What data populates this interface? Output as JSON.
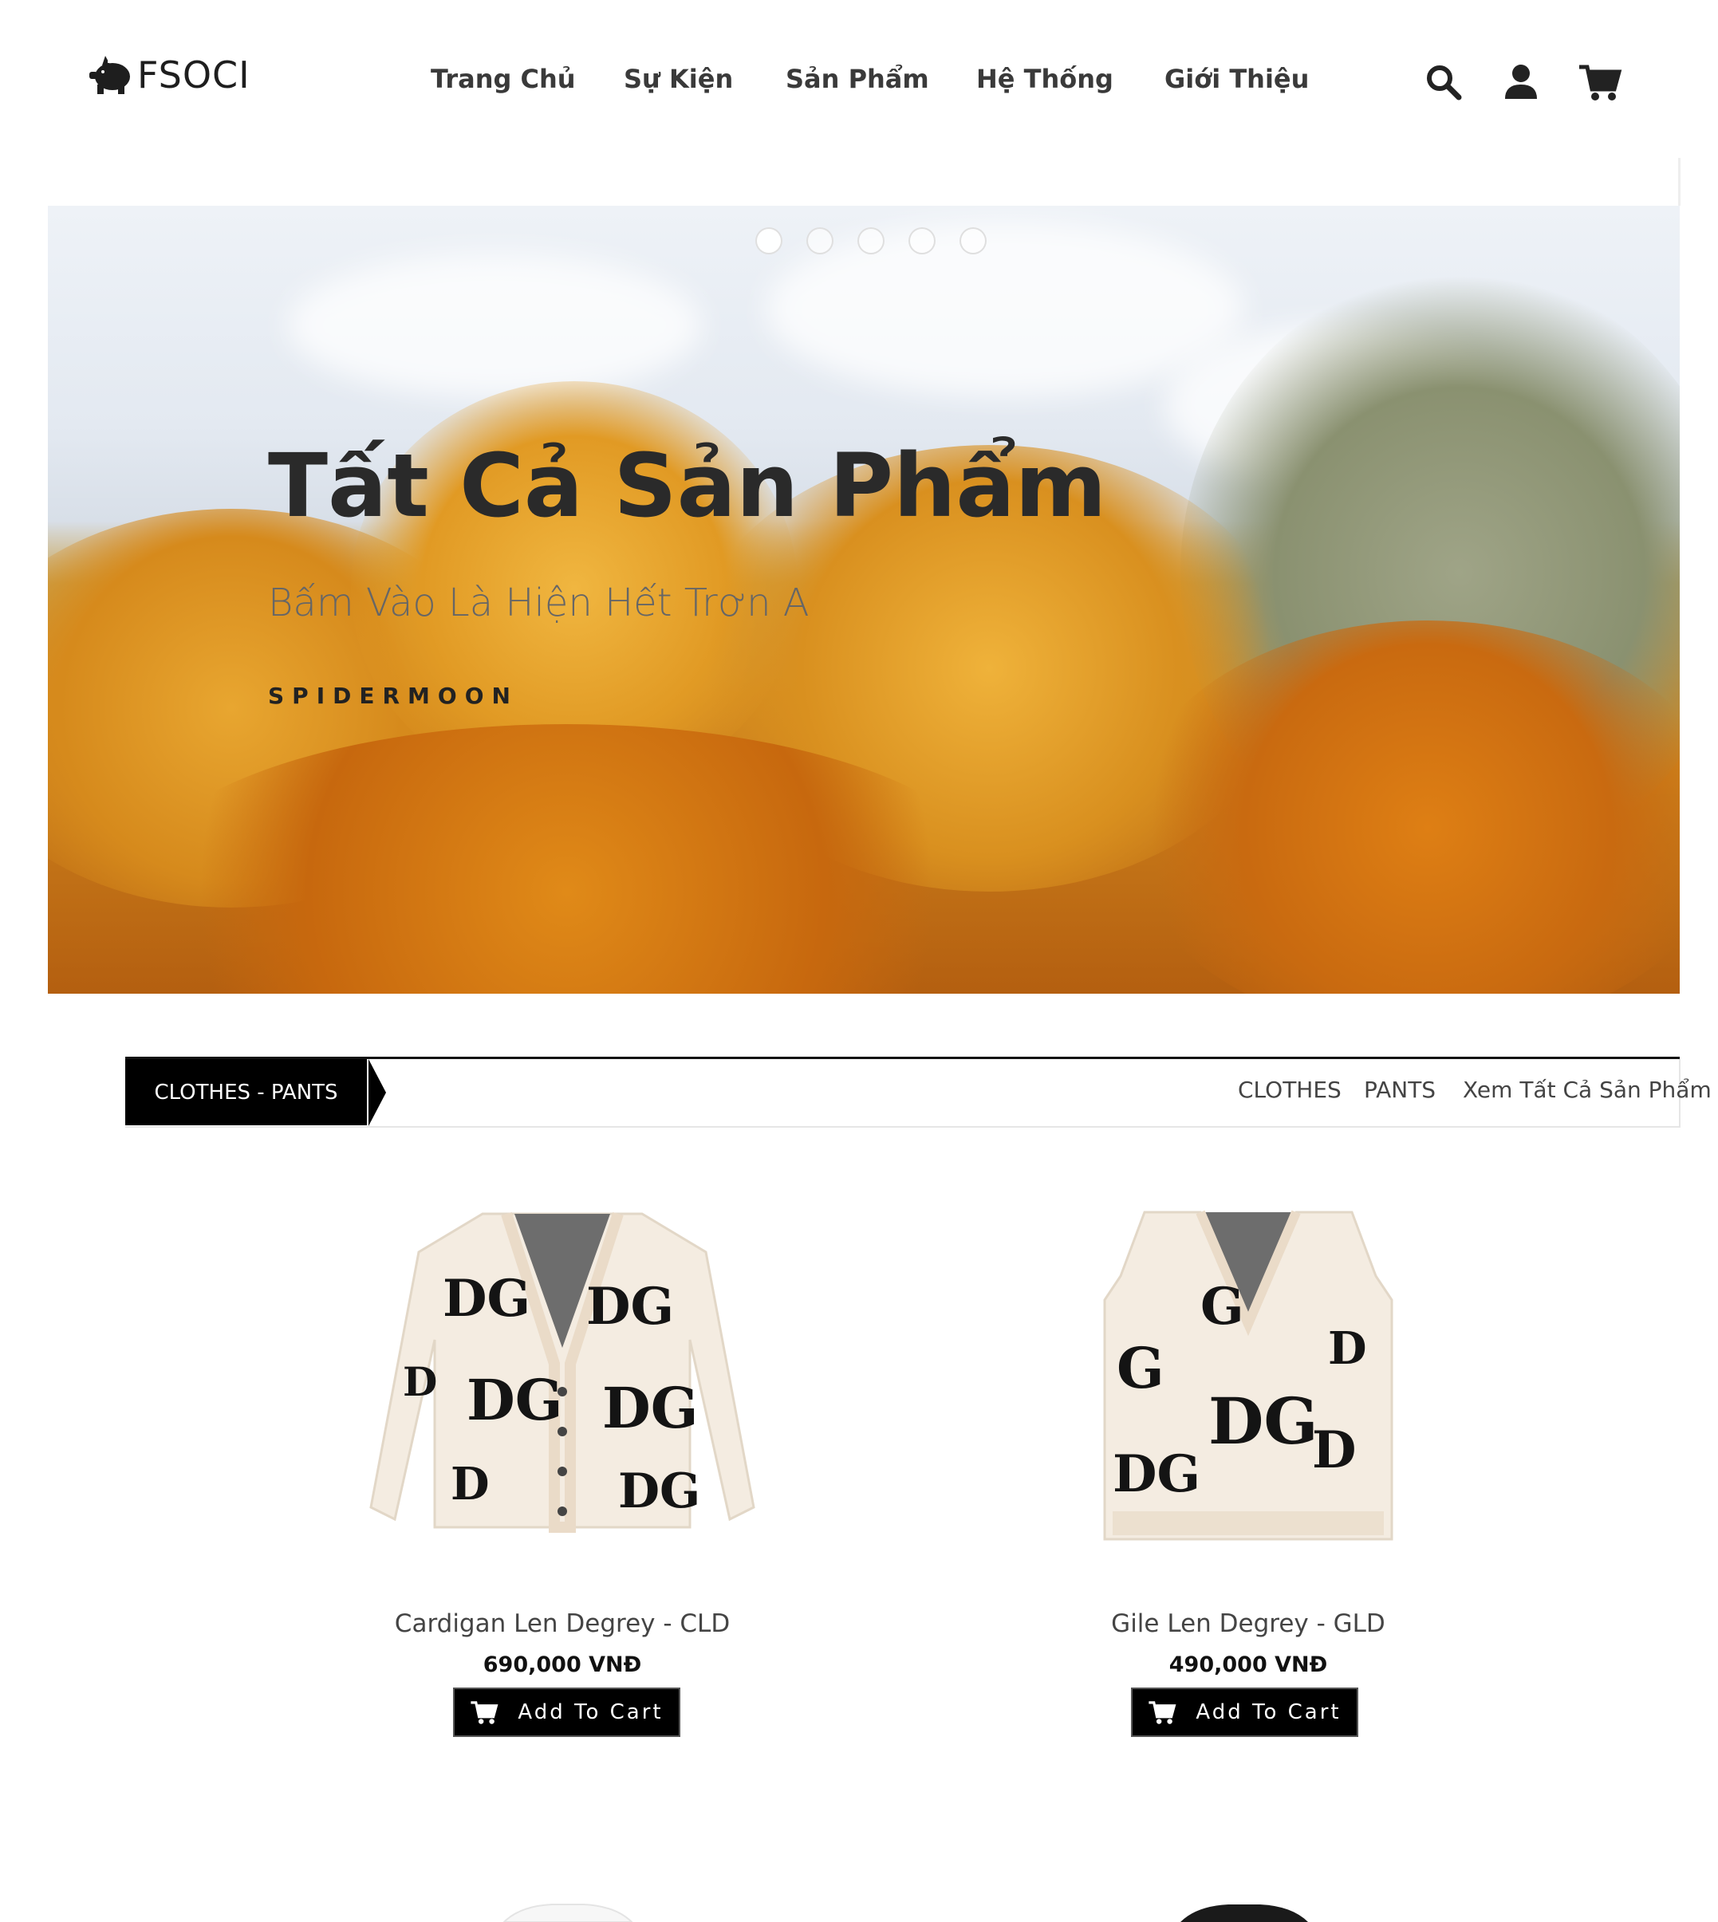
{
  "header": {
    "logo_text": "FSOCI",
    "nav": [
      "Trang Chủ",
      "Sự Kiện",
      "Sản Phẩm",
      "Hệ Thống",
      "Giới Thiệu"
    ],
    "icons": [
      "search-icon",
      "user-icon",
      "cart-icon"
    ]
  },
  "hero": {
    "title": "Tất Cả Sản Phẩm",
    "subtitle": "Bấm Vào Là Hiện Hết Trơn A",
    "tag": "SPIDERMOON",
    "slides": 5,
    "active_slide": 1
  },
  "category_bar": {
    "label": "CLOTHES - PANTS",
    "links": [
      "CLOTHES",
      "PANTS",
      "Xem Tất Cả Sản Phẩm"
    ]
  },
  "products": [
    {
      "name": "Cardigan Len Degrey - CLD",
      "price": "690,000 VNĐ",
      "button": "Add To Cart"
    },
    {
      "name": "Gile Len Degrey - GLD",
      "price": "490,000 VNĐ",
      "button": "Add To Cart"
    }
  ],
  "colors": {
    "accent": "#000000",
    "garment_base": "#f4ece1",
    "print": "#141414"
  }
}
